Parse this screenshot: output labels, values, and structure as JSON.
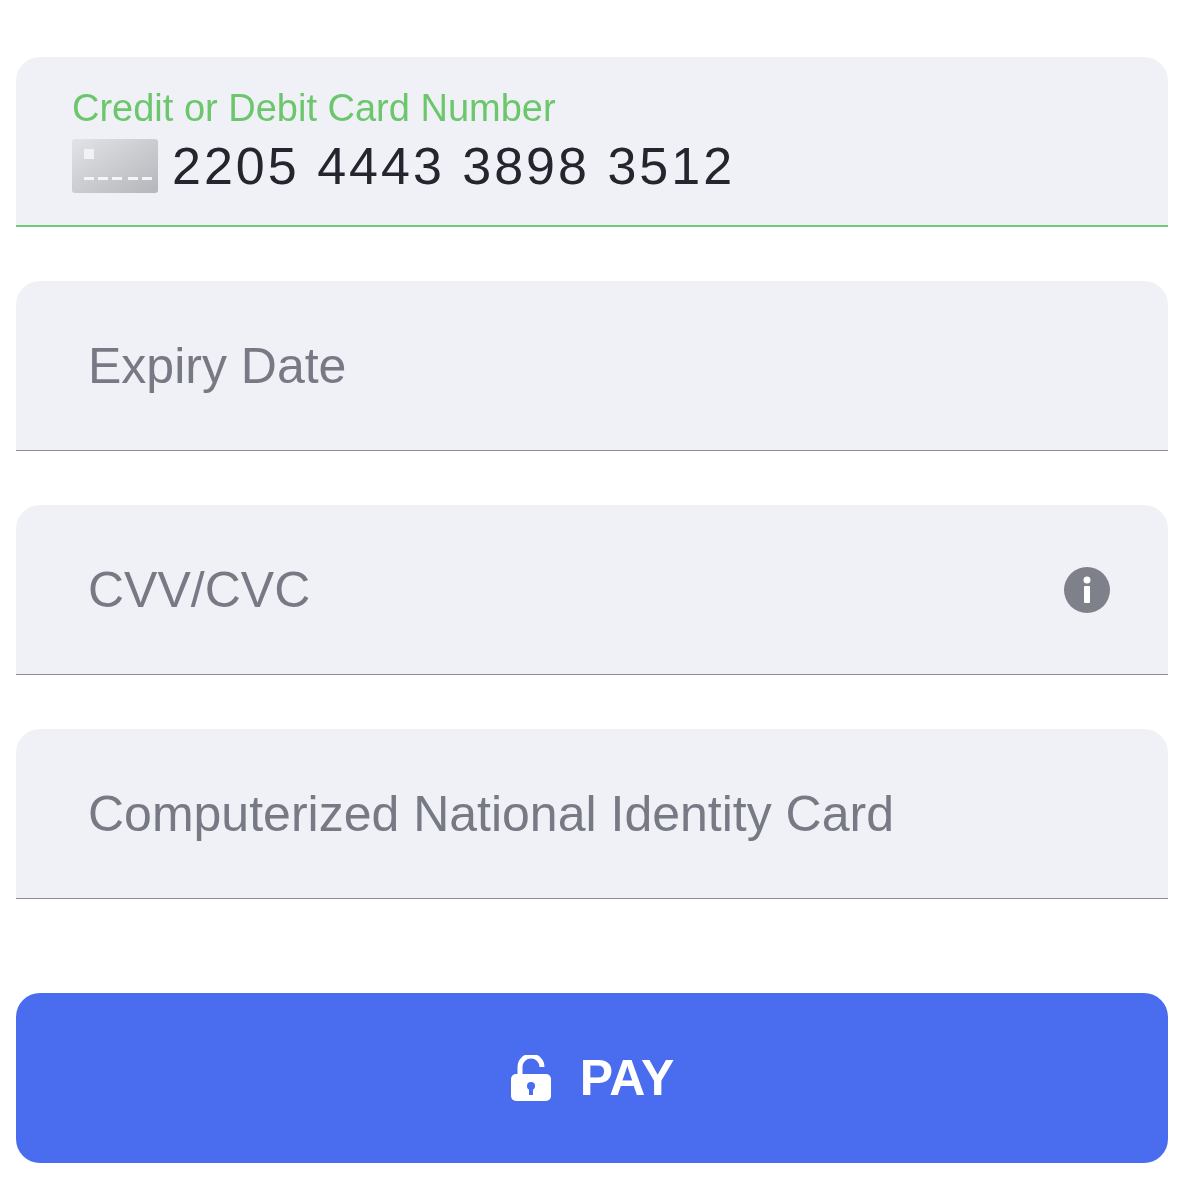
{
  "fields": [
    {
      "kind": "card",
      "label": "Credit or Debit Card Number",
      "value": "2205 4443 3898 3512",
      "focused": true
    },
    {
      "kind": "plain",
      "placeholder": "Expiry Date",
      "focused": false
    },
    {
      "kind": "info",
      "placeholder": "CVV/CVC",
      "focused": false
    },
    {
      "kind": "plain",
      "placeholder": "Computerized National Identity Card",
      "focused": false
    }
  ],
  "pay_button": {
    "label": "PAY"
  }
}
